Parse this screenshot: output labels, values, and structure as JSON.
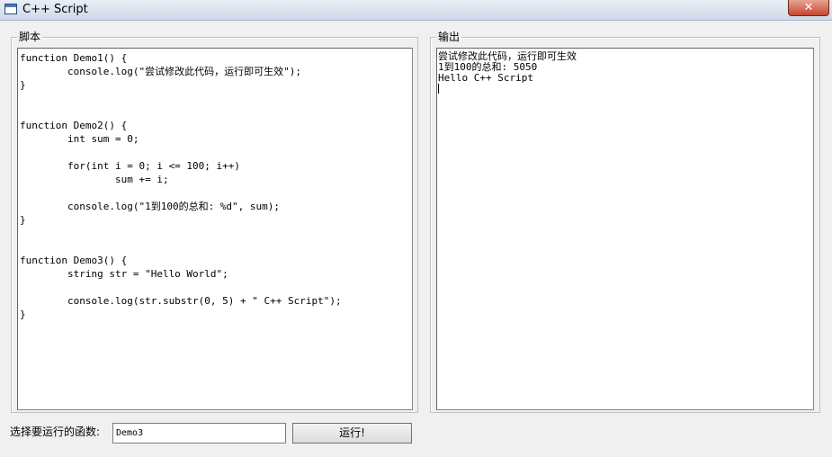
{
  "window": {
    "title": "C++ Script",
    "close_glyph": "✕",
    "icon": "app-window-icon"
  },
  "script_panel": {
    "legend": "脚本",
    "code": "function Demo1() {\n        console.log(\"尝试修改此代码，运行即可生效\");\n}\n\n\nfunction Demo2() {\n        int sum = 0;\n\n        for(int i = 0; i <= 100; i++)\n                sum += i;\n\n        console.log(\"1到100的总和: %d\", sum);\n}\n\n\nfunction Demo3() {\n        string str = \"Hello World\";\n\n        console.log(str.substr(0, 5) + \" C++ Script\");\n}"
  },
  "output_panel": {
    "legend": "输出",
    "lines": [
      "尝试修改此代码，运行即可生效",
      "1到100的总和: 5050",
      "Hello C++ Script"
    ]
  },
  "controls": {
    "function_label": "选择要运行的函数:",
    "function_value": "Demo3",
    "run_label": "运行!"
  }
}
